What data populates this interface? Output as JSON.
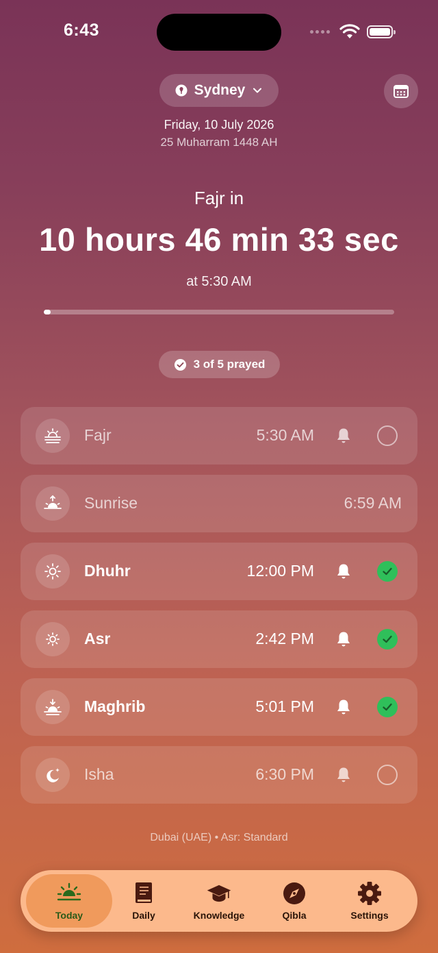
{
  "status_bar": {
    "time": "6:43"
  },
  "header": {
    "city": "Sydney",
    "date": "Friday, 10 July 2026",
    "hijri_date": "25 Muharram 1448 AH"
  },
  "countdown": {
    "label": "Fajr in",
    "remaining": "10 hours 46 min 33 sec",
    "at_time": "at 5:30 AM",
    "progress": 0.02
  },
  "prayed_summary": "3 of 5 prayed",
  "prayers": [
    {
      "name": "Fajr",
      "time": "5:30 AM",
      "icon": "fajr-icon",
      "alert": true,
      "prayed": false
    },
    {
      "name": "Sunrise",
      "time": "6:59 AM",
      "icon": "sunrise-icon",
      "alert": false,
      "prayed": null
    },
    {
      "name": "Dhuhr",
      "time": "12:00 PM",
      "icon": "sun-icon",
      "alert": true,
      "prayed": true
    },
    {
      "name": "Asr",
      "time": "2:42 PM",
      "icon": "sun-small-icon",
      "alert": true,
      "prayed": true
    },
    {
      "name": "Maghrib",
      "time": "5:01 PM",
      "icon": "sunset-icon",
      "alert": true,
      "prayed": true
    },
    {
      "name": "Isha",
      "time": "6:30 PM",
      "icon": "moon-icon",
      "alert": true,
      "prayed": false
    }
  ],
  "footer_info": "Dubai (UAE) • Asr: Standard",
  "tabs": [
    {
      "label": "Today",
      "icon": "sunrise-icon",
      "selected": true
    },
    {
      "label": "Daily",
      "icon": "book-icon",
      "selected": false
    },
    {
      "label": "Knowledge",
      "icon": "graduation-cap-icon",
      "selected": false
    },
    {
      "label": "Qibla",
      "icon": "compass-icon",
      "selected": false
    },
    {
      "label": "Settings",
      "icon": "gear-icon",
      "selected": false
    }
  ],
  "colors": {
    "gradient_top": "#7a3357",
    "gradient_bottom": "#cf6d3e",
    "check_green": "#2fbf5a",
    "tabbar_bg": "#fcb98c",
    "tab_selected_bg": "#f09a5c"
  }
}
